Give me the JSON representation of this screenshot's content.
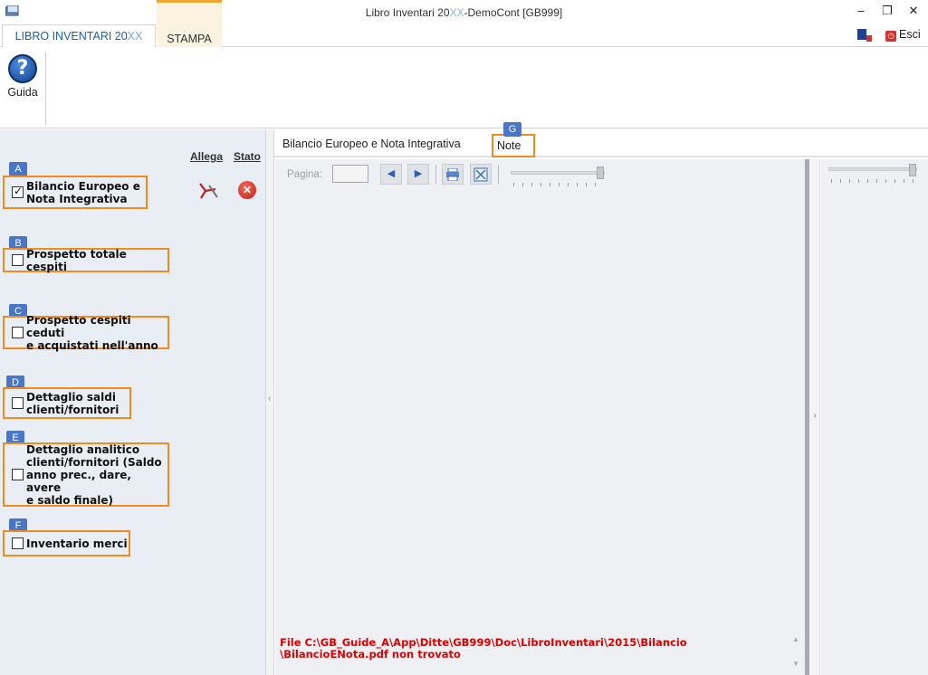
{
  "window": {
    "title": "Libro Inventari 20XX-DemoCont [GB999]",
    "title_prefix": "Libro Inventari 20",
    "title_xx": "XX",
    "title_suffix": "-DemoCont [GB999]",
    "minimize": "–",
    "restore": "❐",
    "close": "✕"
  },
  "ribbon": {
    "tabs": [
      {
        "label_prefix": "LIBRO INVENTARI 20",
        "label_xx": "XX",
        "active": true
      },
      {
        "label": "STAMPA",
        "active": false
      }
    ],
    "esci_label": "Esci",
    "esci_icon_glyph": "⏻",
    "guida_label": "Guida",
    "guida_icon_glyph": "?"
  },
  "left_panel": {
    "headers": {
      "allega": "Allega",
      "stato": "Stato"
    },
    "stato_icon_glyph": "✕",
    "options": [
      {
        "badge": "A",
        "lines": [
          "Bilancio Europeo e",
          "Nota Integrativa"
        ],
        "checked": true
      },
      {
        "badge": "B",
        "lines": [
          "Prospetto totale cespiti"
        ],
        "checked": false
      },
      {
        "badge": "C",
        "lines": [
          "Prospetto cespiti ceduti",
          "e acquistati nell'anno"
        ],
        "checked": false
      },
      {
        "badge": "D",
        "lines": [
          "Dettaglio saldi",
          "clienti/fornitori"
        ],
        "checked": false
      },
      {
        "badge": "E",
        "lines": [
          "Dettaglio analitico",
          "clienti/fornitori (Saldo",
          "anno prec., dare, avere",
          "e saldo finale)"
        ],
        "checked": false
      },
      {
        "badge": "F",
        "lines": [
          "Inventario merci"
        ],
        "checked": false
      }
    ]
  },
  "doc_tabs": {
    "tab1": "Bilancio Europeo e Nota Integrativa",
    "tab2": "Note",
    "tab2_badge": "G"
  },
  "viewer": {
    "pagina_label": "Pagina:",
    "pagina_value": "",
    "prev_glyph": "◀",
    "next_glyph": "▶",
    "error_lines": [
      "File C:\\GB_Guide_A\\App\\Ditte\\GB999\\Doc\\LibroInventari\\2015\\Bilancio",
      "\\BilancioENota.pdf non trovato"
    ]
  },
  "colors": {
    "accent_orange": "#f28a1c",
    "badge_blue": "#4a76c9",
    "error_red": "#e00000",
    "tab_blue": "#1f5f9f"
  }
}
